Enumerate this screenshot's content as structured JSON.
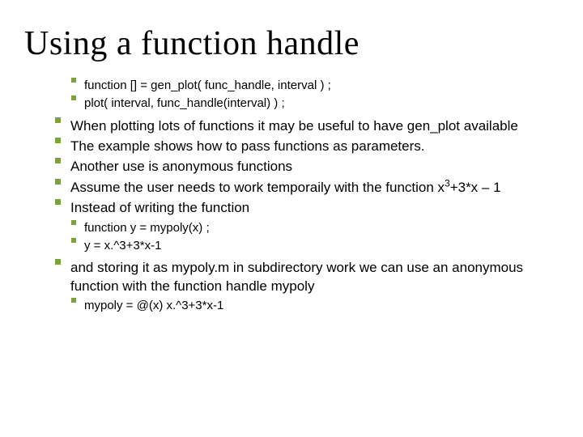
{
  "title": "Using a function handle",
  "code_a": {
    "l1": "function [] = gen_plot( func_handle, interval ) ;",
    "l2": "plot( interval, func_handle(interval) ) ;"
  },
  "body": {
    "b1": "When plotting lots of functions it may be useful to have gen_plot available",
    "b2": "The example shows how to pass functions as parameters.",
    "b3": "Another use is anonymous functions",
    "b4_pre": "Assume the user needs to work temporaily with the function x",
    "b4_sup": "3",
    "b4_post": "+3*x – 1",
    "b5": "Instead of writing the function"
  },
  "code_b": {
    "l1": "function y = mypoly(x) ;",
    "l2": "y = x.^3+3*x-1"
  },
  "body2": {
    "b6": "and storing it as mypoly.m  in subdirectory work we can use an anonymous function with the function handle mypoly"
  },
  "code_c": {
    "l1": "mypoly = @(x) x.^3+3*x-1"
  }
}
